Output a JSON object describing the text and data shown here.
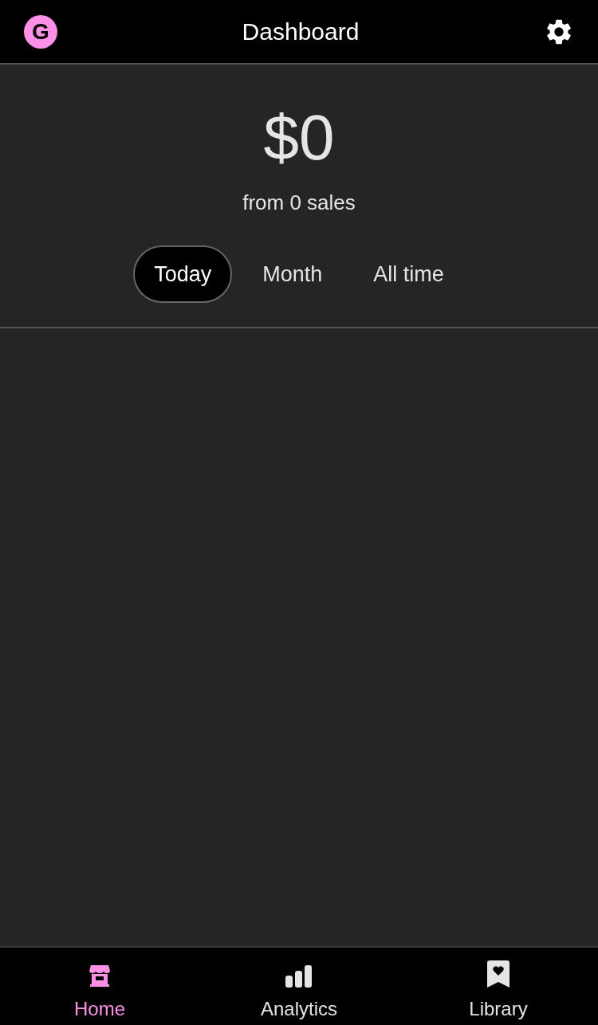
{
  "header": {
    "logo": "G",
    "title": "Dashboard"
  },
  "summary": {
    "amount": "$0",
    "caption": "from 0 sales"
  },
  "periods": [
    {
      "label": "Today",
      "selected": true
    },
    {
      "label": "Month",
      "selected": false
    },
    {
      "label": "All time",
      "selected": false
    }
  ],
  "nav": [
    {
      "kind": "store",
      "label": "Home",
      "selected": true
    },
    {
      "kind": "analytics",
      "label": "Analytics",
      "selected": false
    },
    {
      "kind": "library",
      "label": "Library",
      "selected": false
    }
  ]
}
